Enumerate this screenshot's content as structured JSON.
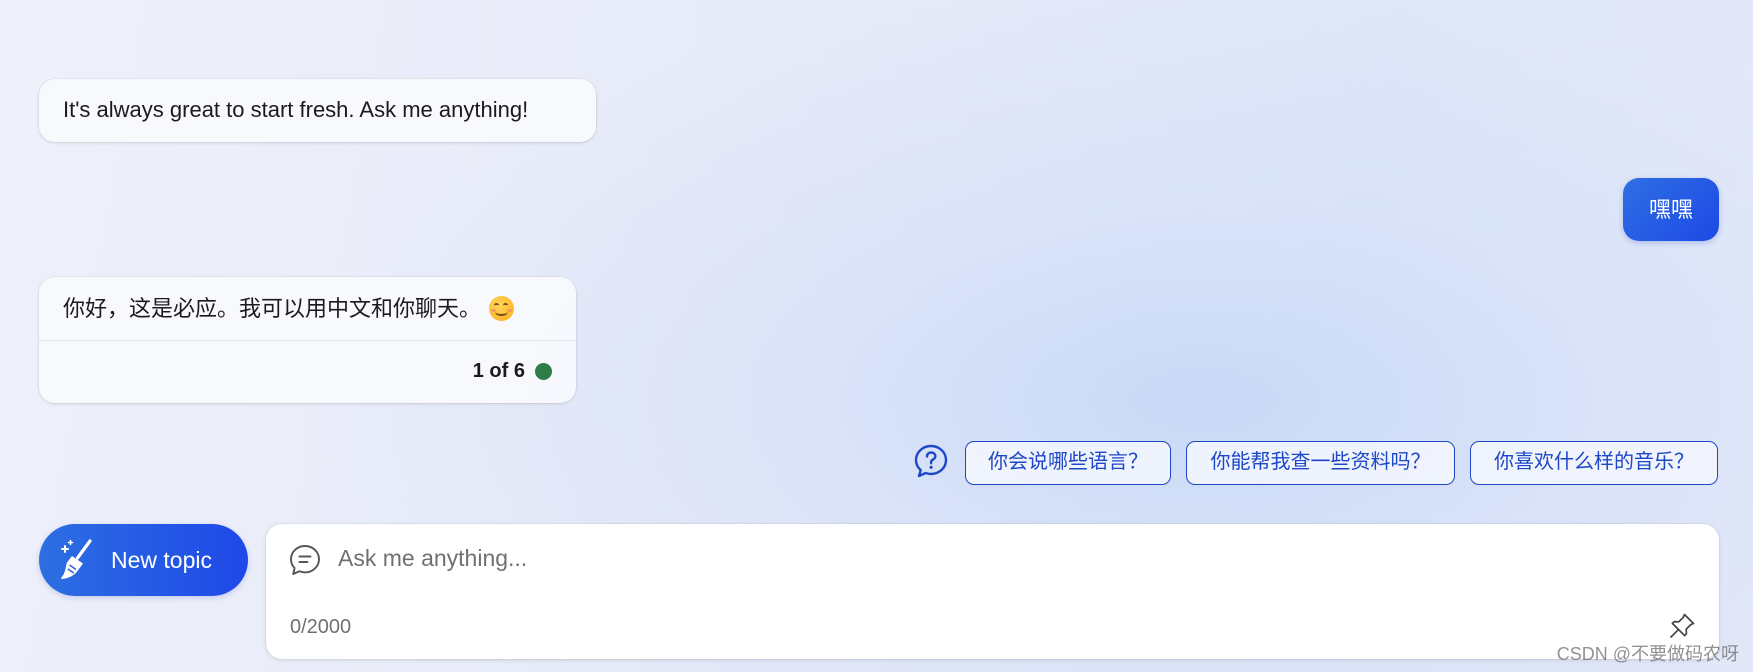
{
  "conversation": {
    "bot_greeting": "It's always great to start fresh. Ask me anything!",
    "user_message": "嘿嘿",
    "bot_reply": "你好，这是必应。我可以用中文和你聊天。",
    "reply_emoji": "smiling-face-icon",
    "reply_counter": "1 of 6",
    "counter_status_color": "#2e7d47"
  },
  "suggestions": {
    "icon": "question-bubble-icon",
    "items": [
      "你会说哪些语言？",
      "你能帮我查一些资料吗？",
      "你喜欢什么样的音乐？"
    ]
  },
  "composer": {
    "new_topic_label": "New topic",
    "new_topic_icon": "broom-icon",
    "chat_icon": "chat-bubble-icon",
    "placeholder": "Ask me anything...",
    "char_count": "0/2000",
    "pin_icon": "pin-icon"
  },
  "watermark": "CSDN @不要做码农呀",
  "colors": {
    "accent": "#1e48e8",
    "suggestion_border": "#1e47c8"
  }
}
